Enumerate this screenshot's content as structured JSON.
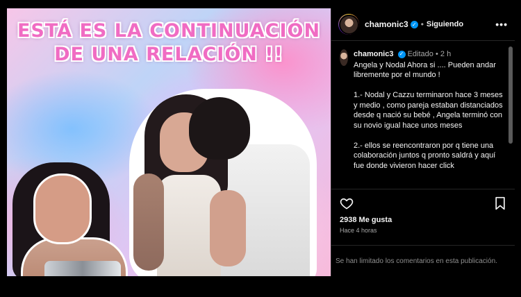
{
  "media": {
    "headline_line1": "ESTÁ ES LA CONTINUACIÓN",
    "headline_line2": "DE UNA RELACIÓN !!"
  },
  "header": {
    "username": "chamonic3",
    "separator": "•",
    "follow_status": "Siguiendo",
    "more_label": "•••"
  },
  "caption": {
    "username": "chamonic3",
    "edited": "Editado",
    "separator": "•",
    "age": "2 h",
    "text": "Angela y Nodal Ahora si .... Pueden andar libremente por el mundo !\n\n1.- Nodal y Cazzu terminaron hace 3 meses y medio , como pareja estaban distanciados desde q nació su bebé , Angela terminó con su novio igual hace unos meses\n\n2.- ellos se reencontraron por q tiene una colaboración juntos q pronto saldrá y aquí fue donde vivieron hacer click"
  },
  "actions": {
    "likes": "2938 Me gusta",
    "time": "Hace 4 horas"
  },
  "footer": {
    "limited_comments": "Se han limitado los comentarios en esta publicación."
  },
  "icons": {
    "heart": "heart-icon",
    "save": "bookmark-icon",
    "verified": "verified-badge-icon",
    "more": "more-options-icon"
  },
  "colors": {
    "background": "#000000",
    "verified": "#0095f6",
    "headline": "#f06cc3",
    "muted": "#a8a8a8"
  }
}
